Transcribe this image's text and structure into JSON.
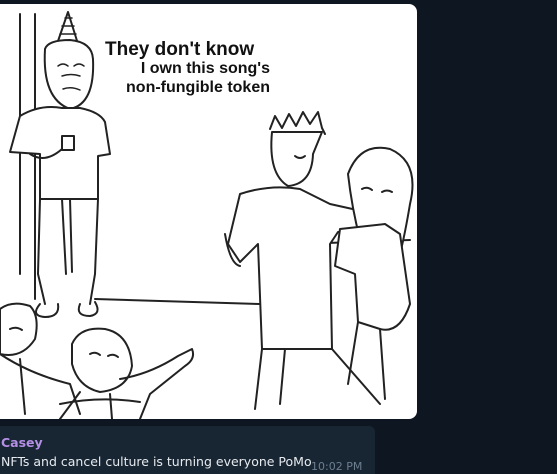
{
  "image": {
    "caption_line1": "They don't know",
    "caption_line2": "I own this song's",
    "caption_line3": "non-fungible token"
  },
  "message": {
    "sender": "Casey",
    "text": "NFTs and cancel culture is turning everyone PoMo",
    "time": "10:02 PM"
  },
  "colors": {
    "background": "#0e1621",
    "bubble": "#182533",
    "sender": "#b48fe6",
    "text": "#e6ebef",
    "time": "#6d7f8f"
  }
}
